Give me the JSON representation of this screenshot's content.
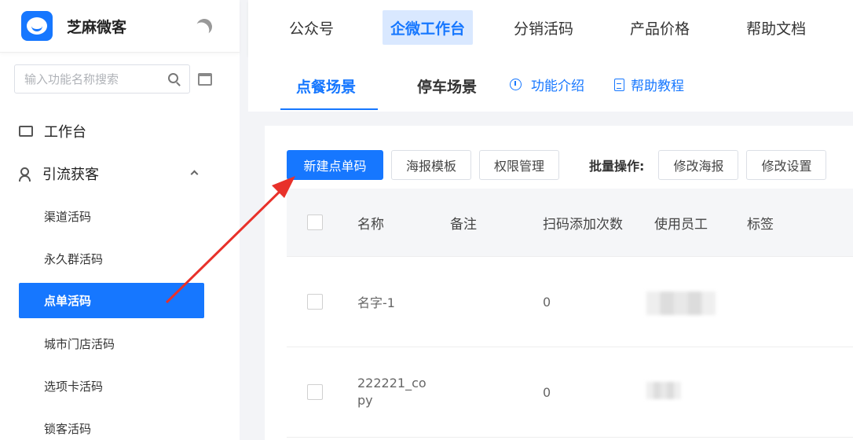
{
  "brand": {
    "name": "芝麻微客"
  },
  "search": {
    "placeholder": "输入功能名称搜索"
  },
  "sidebar": {
    "items": [
      {
        "label": "工作台"
      },
      {
        "label": "引流获客"
      }
    ],
    "sub_items": [
      {
        "label": "渠道活码"
      },
      {
        "label": "永久群活码"
      },
      {
        "label": "点单活码"
      },
      {
        "label": "城市门店活码"
      },
      {
        "label": "选项卡活码"
      },
      {
        "label": "锁客活码"
      }
    ]
  },
  "topnav": {
    "items": [
      {
        "label": "公众号"
      },
      {
        "label": "企微工作台"
      },
      {
        "label": "分销活码"
      },
      {
        "label": "产品价格"
      },
      {
        "label": "帮助文档"
      }
    ]
  },
  "tabs": {
    "items": [
      {
        "label": "点餐场景"
      },
      {
        "label": "停车场景"
      }
    ],
    "links": [
      {
        "label": "功能介绍"
      },
      {
        "label": "帮助教程"
      }
    ]
  },
  "toolbar": {
    "new_label": "新建点单码",
    "poster_template_label": "海报模板",
    "permission_label": "权限管理",
    "batch_label": "批量操作:",
    "edit_poster_label": "修改海报",
    "edit_settings_label": "修改设置"
  },
  "table": {
    "headers": [
      "名称",
      "备注",
      "扫码添加次数",
      "使用员工",
      "标签"
    ],
    "rows": [
      {
        "name": "名字-1",
        "remark": "",
        "scan_count": "0"
      },
      {
        "name": "222221_copy",
        "remark": "",
        "scan_count": "0"
      }
    ]
  },
  "colors": {
    "accent": "#1677ff",
    "arrow": "#e8312a"
  }
}
